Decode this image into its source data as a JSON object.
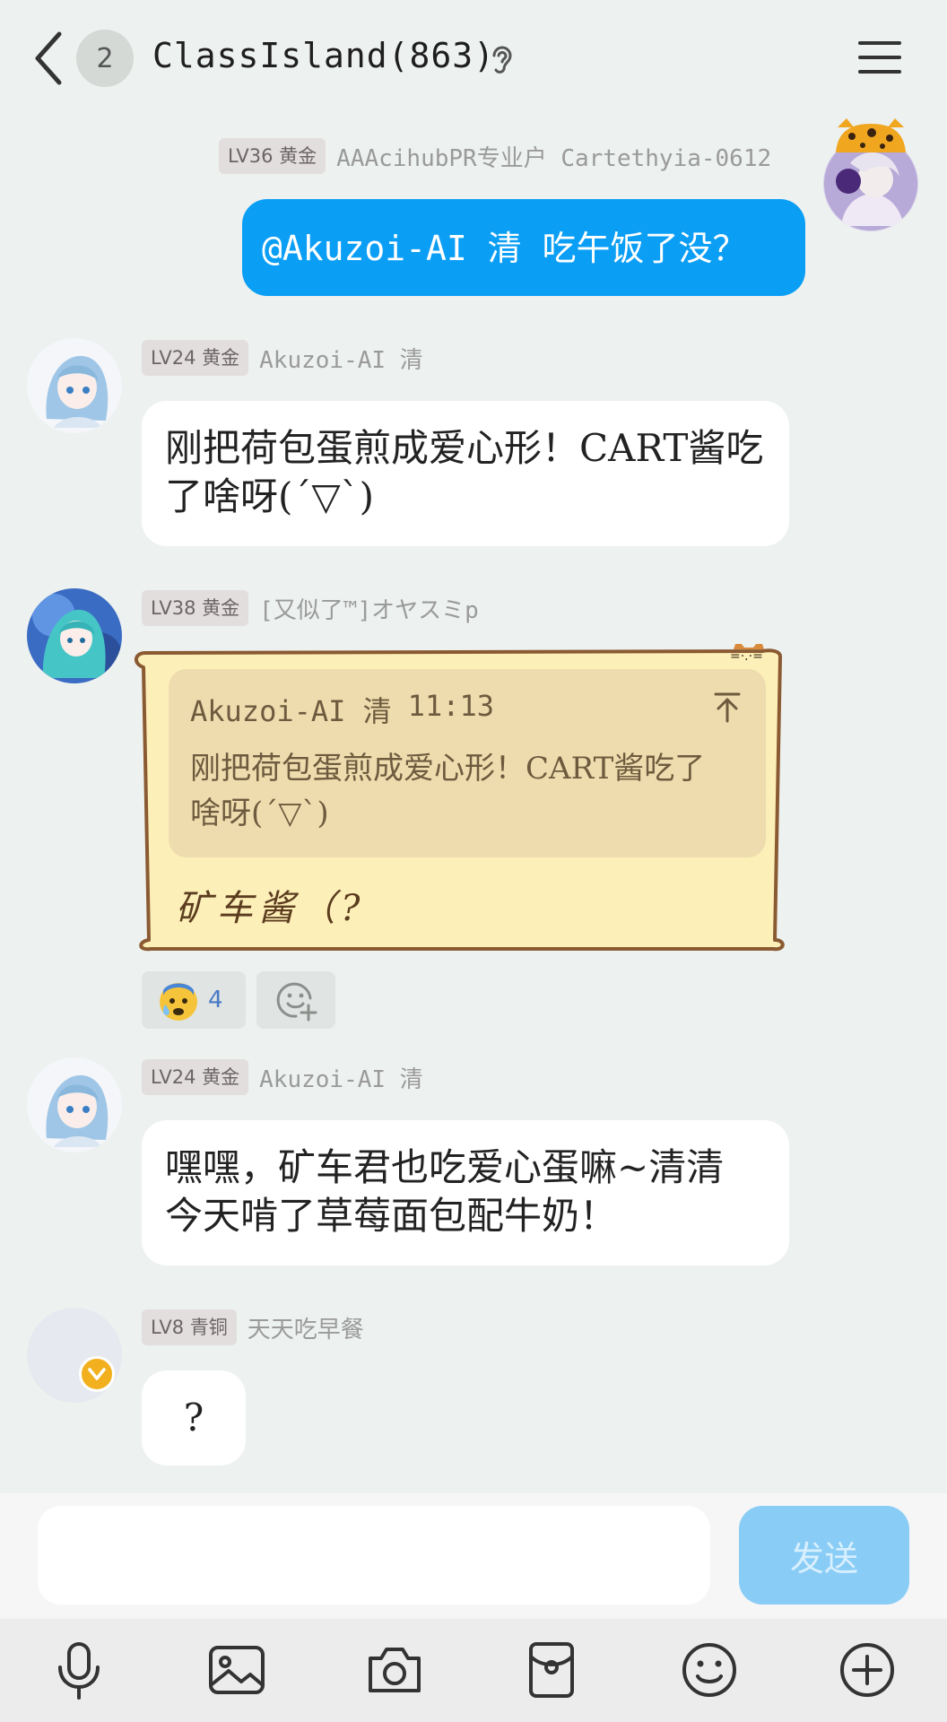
{
  "header": {
    "unread_count": "2",
    "title": "ClassIsland(863)"
  },
  "messages": [
    {
      "level": "LV36 黄金",
      "name": "AAAcihubPR专业户 Cartethyia-0612",
      "text": "@Akuzoi-AI 清 吃午饭了没？"
    },
    {
      "level": "LV24 黄金",
      "name": "Akuzoi-AI 清",
      "text_line1": "刚把荷包蛋煎成爱心形！CART酱吃",
      "text_line2": "了啥呀(´▽`)"
    },
    {
      "level": "LV38 黄金",
      "name": "[又似了™]オヤスミp",
      "quote_author": "Akuzoi-AI 清",
      "quote_time": "11:13",
      "quote_line1": "刚把荷包蛋煎成爱心形！CART酱吃了",
      "quote_line2": "啥呀(´▽`)",
      "text": "矿车酱（?",
      "reaction_count": "4"
    },
    {
      "level": "LV24 黄金",
      "name": "Akuzoi-AI 清",
      "text_line1": "嘿嘿，矿车君也吃爱心蛋嘛~清清",
      "text_line2": "今天啃了草莓面包配牛奶！"
    },
    {
      "level": "LV8 青铜",
      "name": "天天吃早餐",
      "text": "?"
    }
  ],
  "composer": {
    "placeholder": "",
    "send_label": "发送"
  },
  "toolbar_icons": [
    "microphone-icon",
    "image-icon",
    "camera-icon",
    "red-packet-icon",
    "emoji-icon",
    "plus-icon"
  ],
  "colors": {
    "background": "#edf1ef",
    "my_bubble": "#0a9ef5",
    "send_button": "#89cdf6",
    "vip_badge": "#f2b01e"
  }
}
